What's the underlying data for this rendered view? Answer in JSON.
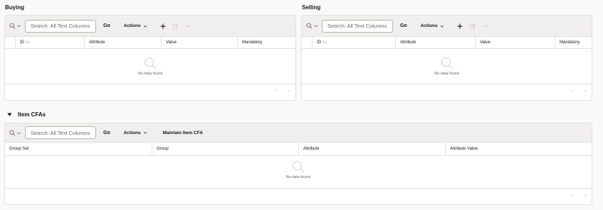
{
  "buying": {
    "title": "Buying",
    "search_placeholder": "Search: All Text Columns",
    "go_label": "Go",
    "actions_label": "Actions",
    "columns": [
      "ID ↑↓",
      "Attribute",
      "Value",
      "Mandatory"
    ],
    "no_data_text": "No data found",
    "pager_prev": "‹",
    "pager_next": "›"
  },
  "selling": {
    "title": "Selling",
    "search_placeholder": "Search: All Text Columns",
    "go_label": "Go",
    "actions_label": "Actions",
    "columns": [
      "ID ↑↓",
      "Attribute",
      "Value",
      "Mandatory"
    ],
    "no_data_text": "No data found",
    "pager_prev": "‹",
    "pager_next": "›"
  },
  "item_cfas": {
    "title": "Item CFAs",
    "search_placeholder": "Search: All Text Columns",
    "go_label": "Go",
    "actions_label": "Actions",
    "maintain_label": "Maintain Item CFA",
    "columns": [
      "Group Set",
      "Group",
      "Attribute",
      "Attribute Value"
    ],
    "no_data_text": "No data found",
    "pager_prev": "‹",
    "pager_next": "›"
  },
  "colors": {
    "toolbar_bg": "#f1efed",
    "border": "#e4e1dd",
    "text": "#161513",
    "muted": "#6f6964"
  },
  "icons": [
    "search-icon",
    "chevron-down-icon",
    "plus-icon",
    "edit-icon",
    "delete-icon",
    "no-data-search-icon",
    "caret-down-icon"
  ]
}
